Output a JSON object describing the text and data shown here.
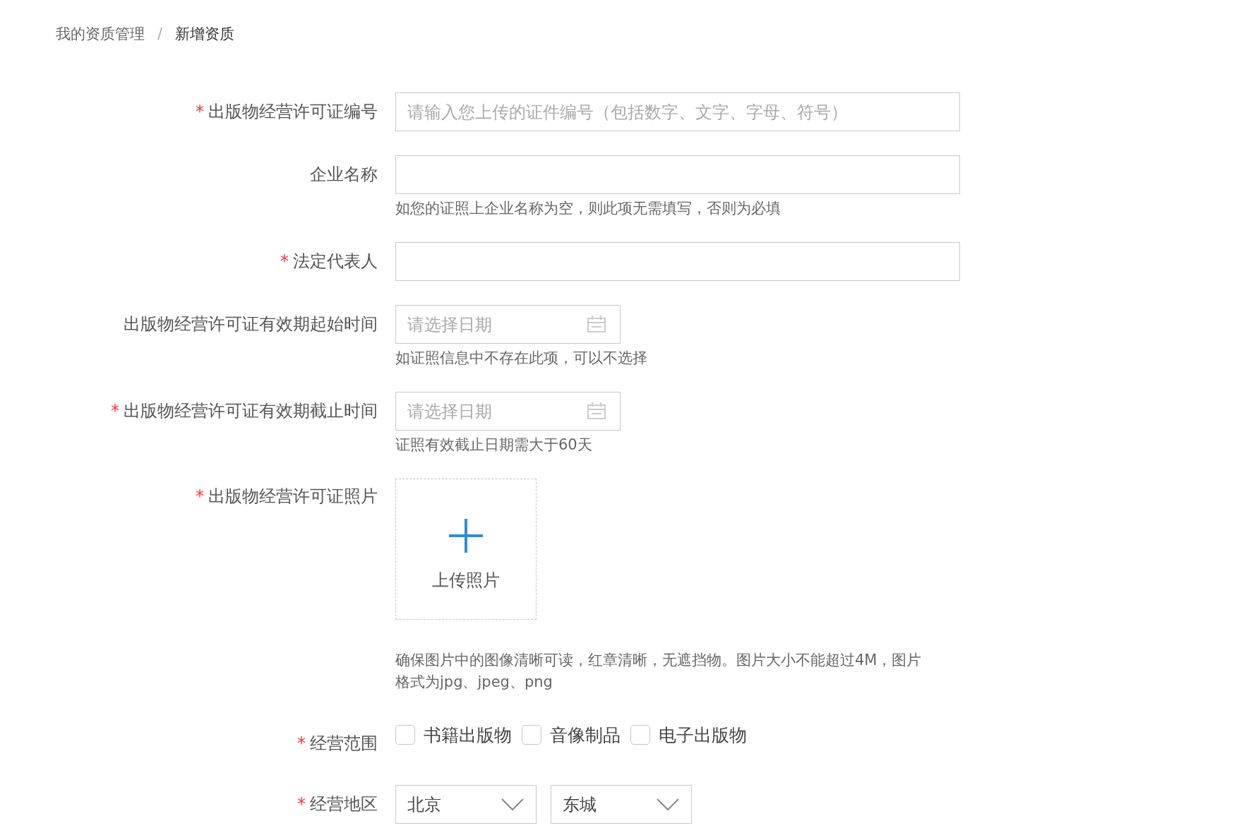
{
  "required_mark": "*",
  "breadcrumb": {
    "items": [
      "我的资质管理",
      "新增资质"
    ],
    "separator": "/"
  },
  "fields": [
    {
      "kind": "text",
      "required": true,
      "label": "出版物经营许可证编号",
      "placeholder": "请输入您上传的证件编号（包括数字、文字、字母、符号）"
    },
    {
      "kind": "text",
      "required": false,
      "label": "企业名称",
      "hint": "如您的证照上企业名称为空，则此项无需填写，否则为必填"
    },
    {
      "kind": "text",
      "required": true,
      "label": "法定代表人"
    },
    {
      "kind": "date",
      "required": false,
      "label": "出版物经营许可证有效期起始时间",
      "placeholder": "请选择日期",
      "hint": "如证照信息中不存在此项，可以不选择"
    },
    {
      "kind": "date",
      "required": true,
      "label": "出版物经营许可证有效期截止时间",
      "placeholder": "请选择日期",
      "hint": "证照有效截止日期需大于60天"
    },
    {
      "kind": "upload",
      "required": true,
      "label": "出版物经营许可证照片",
      "button": "上传照片",
      "hint": "确保图片中的图像清晰可读，红章清晰，无遮挡物。图片大小不能超过4M，图片格式为jpg、jpeg、png"
    },
    {
      "kind": "checkboxes",
      "required": true,
      "label": "经营范围",
      "options": [
        {
          "label": "书籍出版物",
          "checked": false
        },
        {
          "label": "音像制品",
          "checked": false
        },
        {
          "label": "电子出版物",
          "checked": false
        }
      ]
    },
    {
      "kind": "selects",
      "required": true,
      "label": "经营地区",
      "values": [
        "北京",
        "东城"
      ]
    }
  ]
}
